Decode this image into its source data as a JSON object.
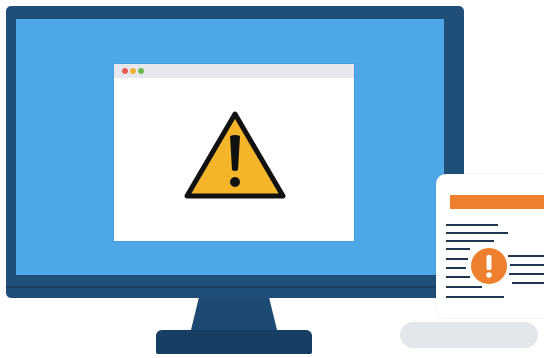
{
  "illustration": {
    "icons": {
      "warning": "warning-triangle-icon",
      "alert": "alert-circle-icon"
    },
    "colors": {
      "bezel": "#1f4f79",
      "screen": "#4ea7e7",
      "warning_fill": "#f5b52b",
      "warning_stroke": "#111111",
      "document_accent": "#ee7f2d",
      "document_lines": "#1f3550"
    }
  }
}
